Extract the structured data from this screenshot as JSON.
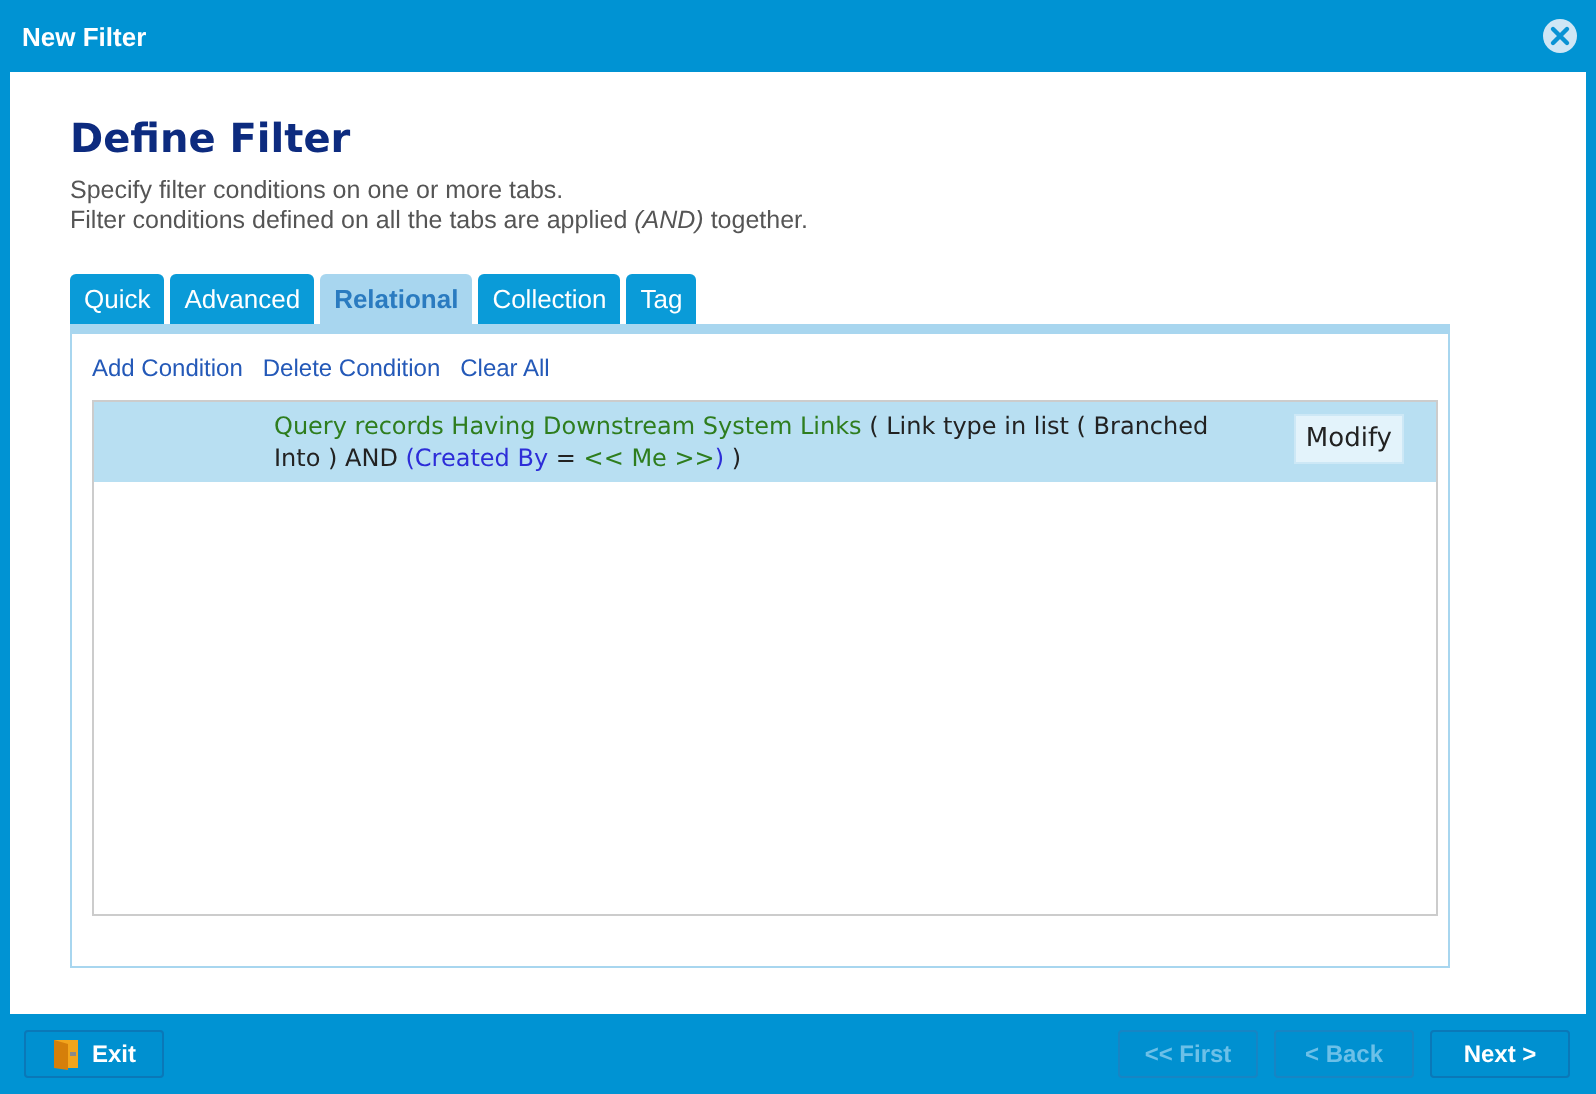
{
  "window": {
    "title": "New Filter"
  },
  "heading": "Define Filter",
  "description": [
    "Specify filter conditions on one or more tabs.",
    "Filter conditions defined on all the tabs are applied *(AND)* together."
  ],
  "tabs": [
    {
      "label": "Quick",
      "selected": false
    },
    {
      "label": "Advanced",
      "selected": false
    },
    {
      "label": "Relational",
      "selected": true
    },
    {
      "label": "Collection",
      "selected": false
    },
    {
      "label": "Tag",
      "selected": false
    }
  ],
  "actions": [
    "Add Condition",
    "Delete Condition",
    "Clear All"
  ],
  "conditions": [
    {
      "selected": true,
      "button": "Modify",
      "segments": [
        {
          "kind": "entity",
          "text": "Query records Having Downstream System Links"
        },
        {
          "kind": "plain",
          "text": " ( Link type in list ( Branched Into ) AND "
        },
        {
          "kind": "group",
          "text": "(Created By"
        },
        {
          "kind": "plain",
          "text": " = "
        },
        {
          "kind": "entity",
          "text": "<< Me >>"
        },
        {
          "kind": "group",
          "text": ")"
        },
        {
          "kind": "plain",
          "text": " )"
        }
      ]
    }
  ],
  "footer": {
    "exit": "Exit",
    "nav": [
      {
        "label": "<< First",
        "disabled": true
      },
      {
        "label": "< Back",
        "disabled": true
      },
      {
        "label": "Next >",
        "disabled": false
      }
    ]
  }
}
